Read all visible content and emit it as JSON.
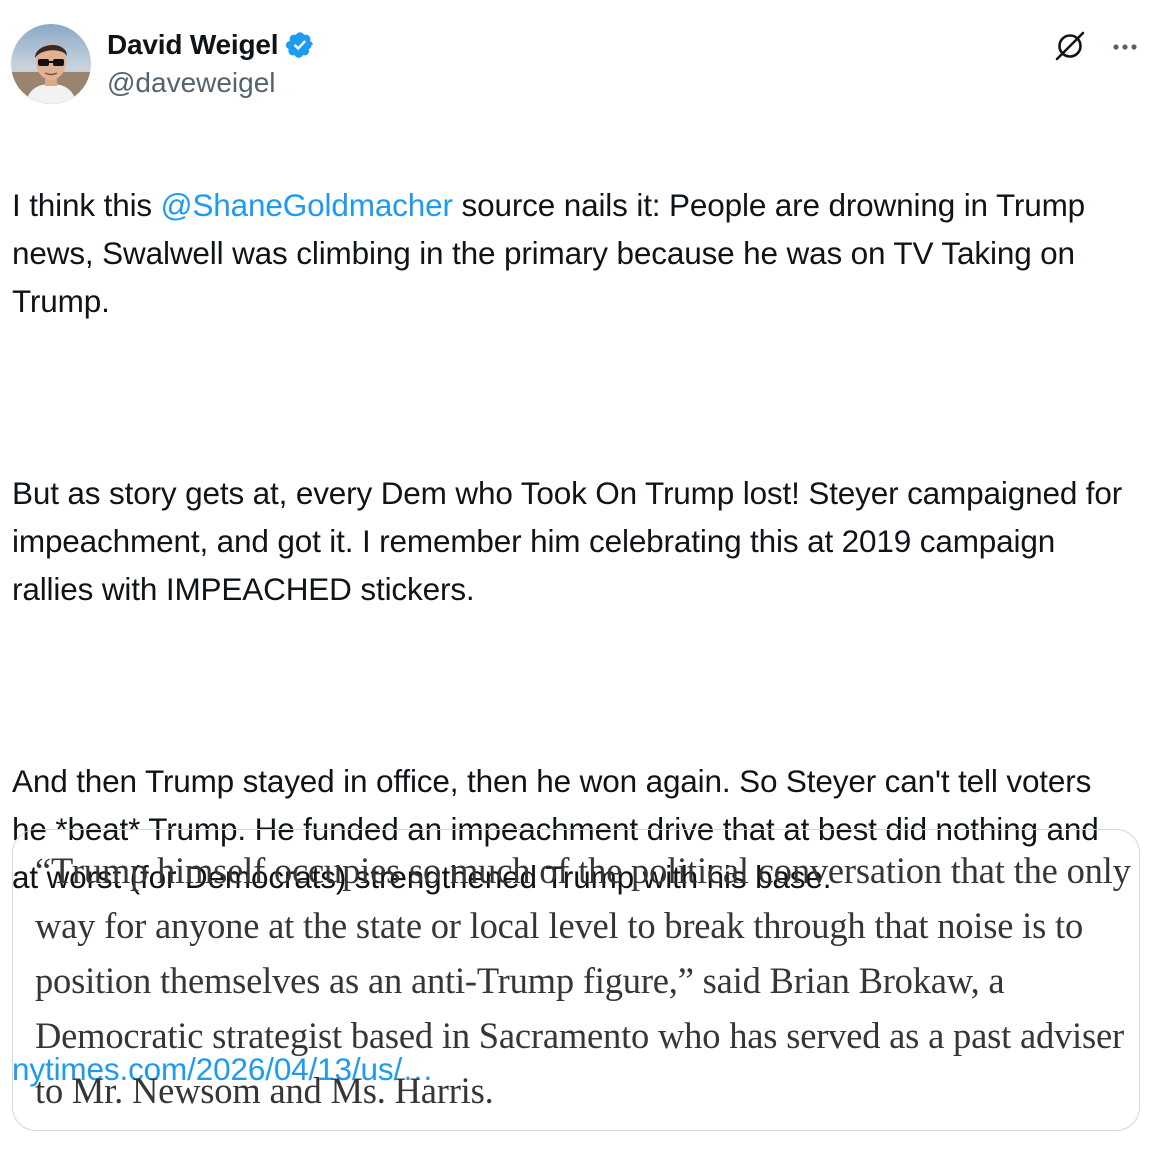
{
  "author": {
    "display_name": "David Weigel",
    "handle": "@daveweigel",
    "verified": true,
    "avatar_icon": "user-avatar-photo"
  },
  "header_actions": {
    "grok_icon": "grok-icon",
    "more_icon": "more-horizontal-icon"
  },
  "tweet": {
    "p1_before_mention": "I think this ",
    "p1_mention": "@ShaneGoldmacher",
    "p1_after_mention": " source nails it: People are drowning in Trump news, Swalwell was climbing in the primary because he was on TV Taking on Trump.",
    "p2": "But as story gets at, every Dem who Took On Trump lost! Steyer campaigned for impeachment, and got it. I remember him celebrating this at 2019 campaign rallies with IMPEACHED stickers.",
    "p3": "And then Trump stayed in office, then he won again. So Steyer can't tell voters he *beat* Trump. He funded an impeachment drive that at best did nothing and at worst (for Democrats) strengthened Trump with his base.",
    "link": "nytimes.com/2026/04/13/us/…"
  },
  "quote_card": {
    "text": "“Trump himself occupies so much of the political conversation that the only way for anyone at the state or local level to break through that noise is to position themselves as an anti-Trump figure,” said Brian Brokaw, a Democratic strategist based in Sacramento who has served as a past adviser to Mr. Newsom and Ms. Harris."
  },
  "colors": {
    "text": "#0f1419",
    "secondary": "#536471",
    "link": "#1d9bf0",
    "verified": "#1d9bf0",
    "border": "#cfd9de",
    "quote_text": "#363636"
  }
}
